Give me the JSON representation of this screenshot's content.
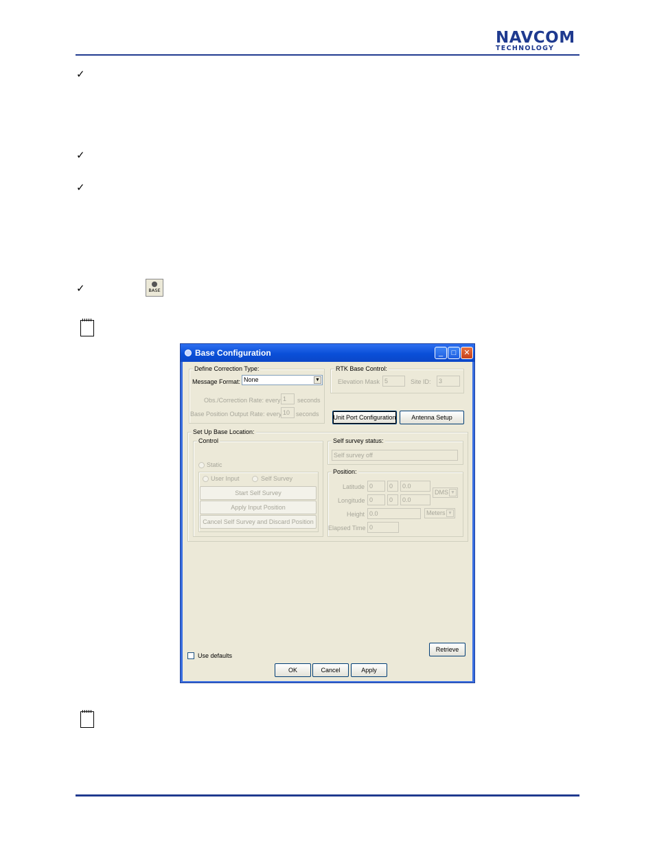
{
  "header": {
    "logo_main": "NAVCOM",
    "logo_sub": "TECHNOLOGY"
  },
  "bullets": {
    "check_glyph": "✓",
    "base_icon_label": "BASE"
  },
  "dialog": {
    "title": "Base Configuration",
    "define_correction": {
      "legend": "Define Correction Type:",
      "message_format_label": "Message Format:",
      "message_format_value": "None",
      "obs_rate_label": "Obs./Correction Rate: every",
      "obs_rate_value": "1",
      "obs_rate_unit": "seconds",
      "base_rate_label": "Base Position Output Rate: every",
      "base_rate_value": "10",
      "base_rate_unit": "seconds"
    },
    "rtk_base_control": {
      "legend": "RTK Base Control:",
      "elevation_mask_label": "Elevation Mask",
      "elevation_mask_value": "5",
      "site_id_label": "Site ID:",
      "site_id_value": "3"
    },
    "buttons": {
      "unit_port": "Unit Port Configuration",
      "antenna_setup": "Antenna Setup",
      "retrieve": "Retrieve",
      "ok": "OK",
      "cancel": "Cancel",
      "apply": "Apply"
    },
    "setup_base": {
      "legend": "Set Up Base Location:",
      "control": {
        "legend": "Control",
        "static_label": "Static",
        "user_input_label": "User Input",
        "self_survey_label": "Self Survey",
        "start_self_survey": "Start Self Survey",
        "apply_input_position": "Apply Input Position",
        "cancel_self_survey": "Cancel Self Survey and Discard Position"
      },
      "self_survey_status": {
        "legend": "Self survey status:",
        "value": "Self survey off"
      },
      "position": {
        "legend": "Position:",
        "latitude_label": "Latitude",
        "latitude_deg": "0",
        "latitude_min": "0",
        "latitude_sec": "0.0",
        "longitude_label": "Longitude",
        "longitude_deg": "0",
        "longitude_min": "0",
        "longitude_sec": "0.0",
        "angle_format": "DMS",
        "height_label": "Height",
        "height_value": "0.0",
        "height_unit": "Meters",
        "elapsed_label": "Elapsed Time",
        "elapsed_value": "0"
      }
    },
    "use_defaults_label": "Use defaults"
  }
}
